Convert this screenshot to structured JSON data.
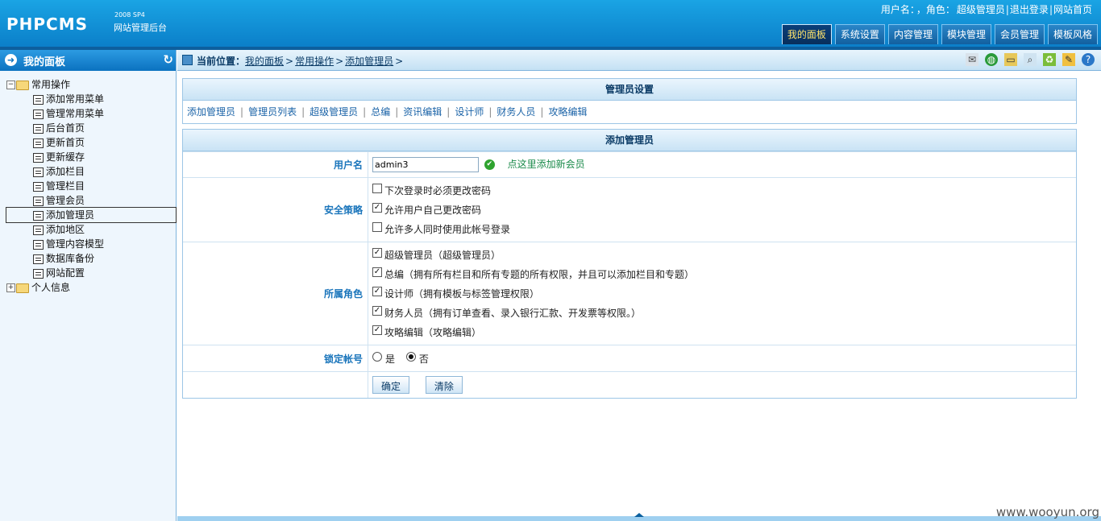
{
  "header": {
    "logo_text": "PHPCMS",
    "logo_version": "2008 SP4",
    "logo_subtitle": "网站管理后台",
    "user_label": "用户名：",
    "role_label": "，角色：",
    "role_value": "超级管理员",
    "logout": "退出登录",
    "site_home": "网站首页",
    "nav": [
      {
        "label": "我的面板",
        "active": true
      },
      {
        "label": "系统设置"
      },
      {
        "label": "内容管理"
      },
      {
        "label": "模块管理"
      },
      {
        "label": "会员管理"
      },
      {
        "label": "模板风格"
      }
    ]
  },
  "sidebar": {
    "title": "我的面板",
    "groups": [
      {
        "label": "常用操作",
        "expanded": true,
        "items": [
          "添加常用菜单",
          "管理常用菜单",
          "后台首页",
          "更新首页",
          "更新缓存",
          "添加栏目",
          "管理栏目",
          "管理会员",
          "添加管理员",
          "添加地区",
          "管理内容模型",
          "数据库备份",
          "网站配置"
        ]
      },
      {
        "label": "个人信息",
        "expanded": false
      }
    ]
  },
  "breadcrumb": {
    "label": "当前位置：",
    "items": [
      "我的面板",
      "常用操作",
      "添加管理员"
    ]
  },
  "settings": {
    "title": "管理员设置",
    "links": [
      "添加管理员",
      "管理员列表",
      "超级管理员",
      "总编",
      "资讯编辑",
      "设计师",
      "财务人员",
      "攻略编辑"
    ]
  },
  "form": {
    "title": "添加管理员",
    "username_label": "用户名",
    "username_value": "admin3",
    "add_member_link": "点这里添加新会员",
    "security_label": "安全策略",
    "security_options": [
      {
        "label": "下次登录时必须更改密码",
        "checked": false
      },
      {
        "label": "允许用户自己更改密码",
        "checked": true
      },
      {
        "label": "允许多人同时使用此帐号登录",
        "checked": false
      }
    ],
    "role_label": "所属角色",
    "roles": [
      {
        "label": "超级管理员（超级管理员）",
        "checked": true
      },
      {
        "label": "总编（拥有所有栏目和所有专题的所有权限，并且可以添加栏目和专题）",
        "checked": true
      },
      {
        "label": "设计师（拥有模板与标签管理权限）",
        "checked": true
      },
      {
        "label": "财务人员（拥有订单查看、录入银行汇款、开发票等权限。）",
        "checked": true
      },
      {
        "label": "攻略编辑（攻略编辑）",
        "checked": true
      }
    ],
    "lock_label": "锁定帐号",
    "lock_yes": "是",
    "lock_no": "否",
    "submit": "确定",
    "clear": "清除"
  },
  "watermark": "www.wooyun.org"
}
